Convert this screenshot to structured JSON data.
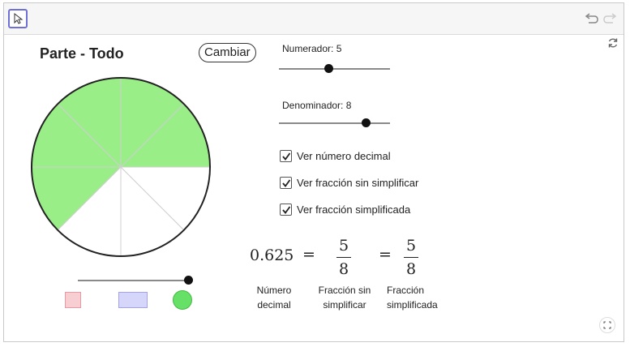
{
  "toolbar": {
    "tool": "cursor-icon",
    "undo": "undo-icon",
    "redo": "redo-icon"
  },
  "title": "Parte - Todo",
  "cambiar_label": "Cambiar",
  "numerador": {
    "label": "Numerador: 5",
    "value": 5,
    "min": 1,
    "max": 10
  },
  "denominador": {
    "label": "Denominador: 8",
    "value": 8,
    "min": 1,
    "max": 10
  },
  "checkboxes": [
    {
      "label": "Ver número decimal",
      "checked": true
    },
    {
      "label": "Ver fracción sin simplificar",
      "checked": true
    },
    {
      "label": "Ver fracción simplificada",
      "checked": true
    }
  ],
  "expression": {
    "decimal": "0.625",
    "equals": "=",
    "unsimplified": {
      "num": "5",
      "den": "8"
    },
    "simplified": {
      "num": "5",
      "den": "8"
    }
  },
  "captions": {
    "decimal": [
      "Número",
      "decimal"
    ],
    "unsimplified": [
      "Fracción sin",
      "simplificar"
    ],
    "simplified": [
      "Fracción",
      "simplificada"
    ]
  },
  "pie": {
    "numerator": 5,
    "denominator": 8,
    "fill": "#99ee88",
    "stroke": "#222222"
  },
  "shape_slider": {
    "value": 1
  },
  "shapes": [
    {
      "name": "square",
      "fill": "#f7cfd3",
      "stroke": "#e79aa3"
    },
    {
      "name": "rectangle",
      "fill": "#d6d6fa",
      "stroke": "#a3a3e6"
    },
    {
      "name": "circle",
      "fill": "#66e066",
      "stroke": "#44bb44"
    }
  ],
  "colors": {
    "accent": "#6f6fd8"
  }
}
